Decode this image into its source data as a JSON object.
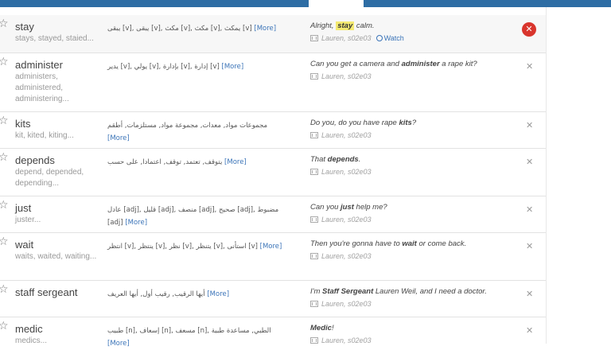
{
  "app": {
    "accent": "#2e6da4"
  },
  "more_label": "[More]",
  "rows": [
    {
      "word": "stay",
      "forms": "stays, stayed, staied...",
      "trans": "يبقى [v], يبقى [v], مكث [v], مكث [v], يمكث [v]",
      "quote_pre": "Alright, ",
      "quote_kw": "stay",
      "quote_post": " calm.",
      "source": "Lauren, s02e03",
      "watch": "Watch"
    },
    {
      "word": "administer",
      "forms": "administers, administered, administering...",
      "trans": "يدير [v], يولي [v], بإدارة [v], إدارة [v]",
      "quote_pre": "Can you get a camera and ",
      "quote_kw": "administer",
      "quote_post": " a rape kit?",
      "source": "Lauren, s02e03"
    },
    {
      "word": "kits",
      "forms": "kit, kited, kiting...",
      "trans": "مجموعات مواد, معدات, مجموعة مواد, مستلزمات, أطقم",
      "quote_pre": "Do you, do you have rape ",
      "quote_kw": "kits",
      "quote_post": "?",
      "source": "Lauren, s02e03"
    },
    {
      "word": "depends",
      "forms": "depend, depended, depending...",
      "trans": "يتوقف, تعتمد, توقف, اعتمادا, على حسب",
      "quote_pre": "That ",
      "quote_kw": "depends",
      "quote_post": ".",
      "source": "Lauren, s02e03"
    },
    {
      "word": "just",
      "forms": "juster...",
      "trans": "عادل [adj], قليل [adj], منصف [adj], صحيح [adj], مضبوط [adj]",
      "quote_pre": "Can you ",
      "quote_kw": "just",
      "quote_post": " help me?",
      "source": "Lauren, s02e03"
    },
    {
      "word": "wait",
      "forms": "waits, waited, waiting...",
      "trans": "انتظر [v], ينتظر [v], نظر [v], يتنظر [v], استأنى [v]",
      "quote_pre": "Then you're gonna have to ",
      "quote_kw": "wait",
      "quote_post": " or come back.",
      "source": "Lauren, s02e03"
    },
    {
      "word": "staff sergeant",
      "forms": "",
      "trans": "أيها الرقيب, رقيب أول, أيها العريف",
      "quote_pre": "I'm ",
      "quote_kw": "Staff Sergeant",
      "quote_post": " Lauren Weil, and I need a doctor.",
      "source": "Lauren, s02e03"
    },
    {
      "word": "medic",
      "forms": "medics...",
      "trans": "طبيب [n], إسعاف [n], مسعف [n], الطبي, مساعدة طبية",
      "quote_pre": "",
      "quote_kw": "Medic",
      "quote_post": "!",
      "source": "Lauren, s02e03"
    }
  ]
}
